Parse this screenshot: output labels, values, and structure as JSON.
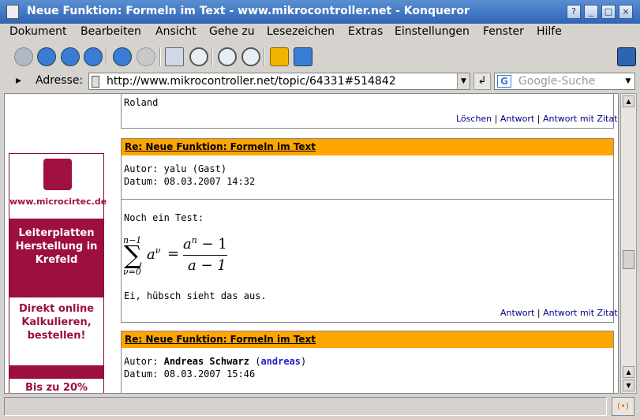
{
  "window": {
    "title": "Neue Funktion: Formeln im Text - www.mikrocontroller.net - Konqueror",
    "btn_help": "?",
    "btn_min": "_",
    "btn_max": "□",
    "btn_close": "×"
  },
  "menu": [
    "Dokument",
    "Bearbeiten",
    "Ansicht",
    "Gehe zu",
    "Lesezeichen",
    "Extras",
    "Einstellungen",
    "Fenster",
    "Hilfe"
  ],
  "address": {
    "label": "Adresse:",
    "url": "http://www.mikrocontroller.net/topic/64331#514842",
    "search_placeholder": "Google-Suche"
  },
  "ad": {
    "site": "www.microcirtec.de",
    "line1": "Leiterplatten Herstellung in Krefeld",
    "line2": "Direkt online Kalkulieren, bestellen!",
    "line3": "Bis zu 20%"
  },
  "posts": [
    {
      "body": "Roland",
      "links": {
        "delete": "Löschen",
        "reply": "Antwort",
        "quote": "Antwort mit Zitat"
      }
    },
    {
      "title": "Re: Neue Funktion: Formeln im Text",
      "author_label": "Autor:",
      "author": "yalu (Gast)",
      "date_label": "Datum:",
      "date": "08.03.2007 14:32",
      "text1": "Noch ein Test:",
      "text2": "Ei, hübsch sieht das aus.",
      "links": {
        "reply": "Antwort",
        "quote": "Antwort mit Zitat"
      }
    },
    {
      "title": "Re: Neue Funktion: Formeln im Text",
      "author_label": "Autor:",
      "author": "Andreas Schwarz",
      "author_nick": "andreas",
      "date_label": "Datum:",
      "date": "08.03.2007 15:46"
    }
  ],
  "formula": {
    "sum_upper": "n−1",
    "sum_lower": "ν=0",
    "term": "a",
    "term_exp": "ν",
    "num": "a",
    "num_exp": "n",
    "num_rest": " − 1",
    "den": "a − 1"
  },
  "separators": {
    "pipe": "|",
    "paren_open": "(",
    "paren_close": ")"
  }
}
